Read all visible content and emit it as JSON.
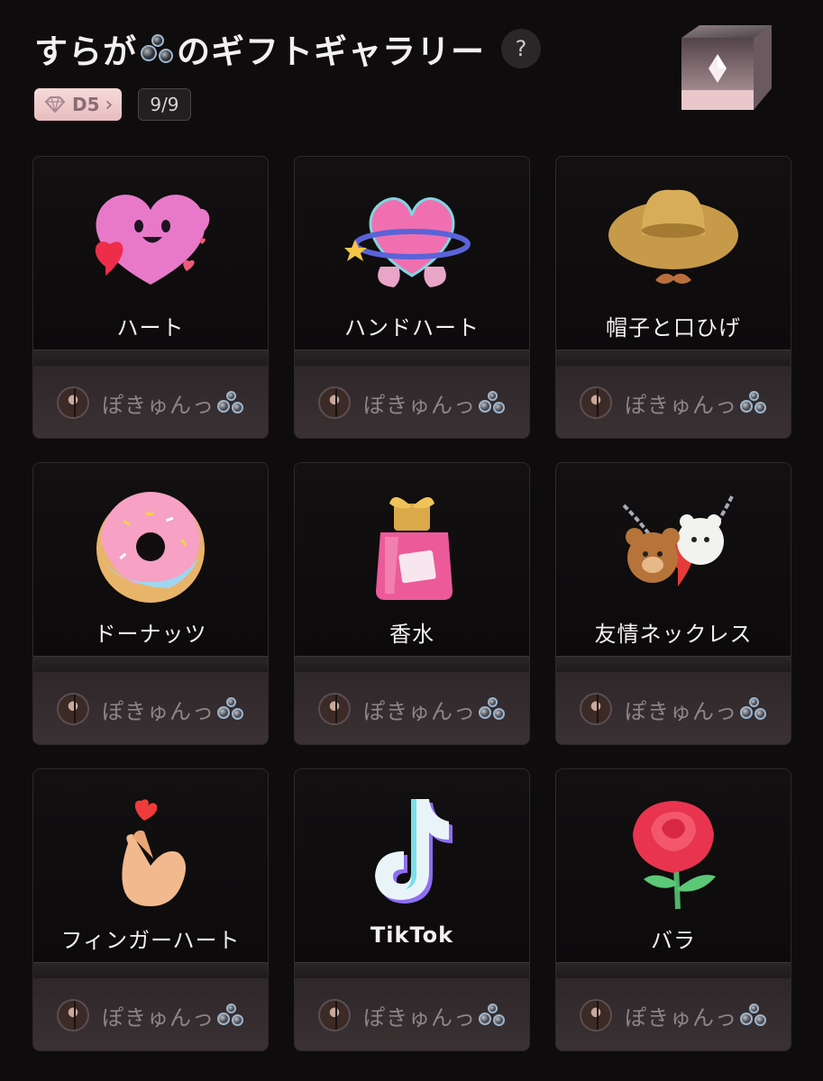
{
  "header": {
    "title_prefix": "すらが",
    "title_suffix": "のギフトギャラリー",
    "help_label": "?",
    "level_badge": "D5",
    "level_chevron": "›",
    "count_badge": "9/9"
  },
  "gifts": [
    {
      "name": "ハート",
      "icon": "heart-character-icon",
      "sender": "ぽきゅんっ"
    },
    {
      "name": "ハンドハート",
      "icon": "hand-heart-icon",
      "sender": "ぽきゅんっ"
    },
    {
      "name": "帽子と口ひげ",
      "icon": "hat-and-mustache-icon",
      "sender": "ぽきゅんっ"
    },
    {
      "name": "ドーナッツ",
      "icon": "donut-icon",
      "sender": "ぽきゅんっ"
    },
    {
      "name": "香水",
      "icon": "perfume-icon",
      "sender": "ぽきゅんっ"
    },
    {
      "name": "友情ネックレス",
      "icon": "friendship-necklace-icon",
      "sender": "ぽきゅんっ"
    },
    {
      "name": "フィンガーハート",
      "icon": "finger-heart-icon",
      "sender": "ぽきゅんっ"
    },
    {
      "name": "TikTok",
      "icon": "tiktok-logo-icon",
      "sender": "ぽきゅんっ"
    },
    {
      "name": "バラ",
      "icon": "rose-icon",
      "sender": "ぽきゅんっ"
    }
  ],
  "colors": {
    "background": "#0f0c0d",
    "card_footer": "#352d2f",
    "badge_pink": "#f0cdcf",
    "sender_text": "#8d8587"
  }
}
